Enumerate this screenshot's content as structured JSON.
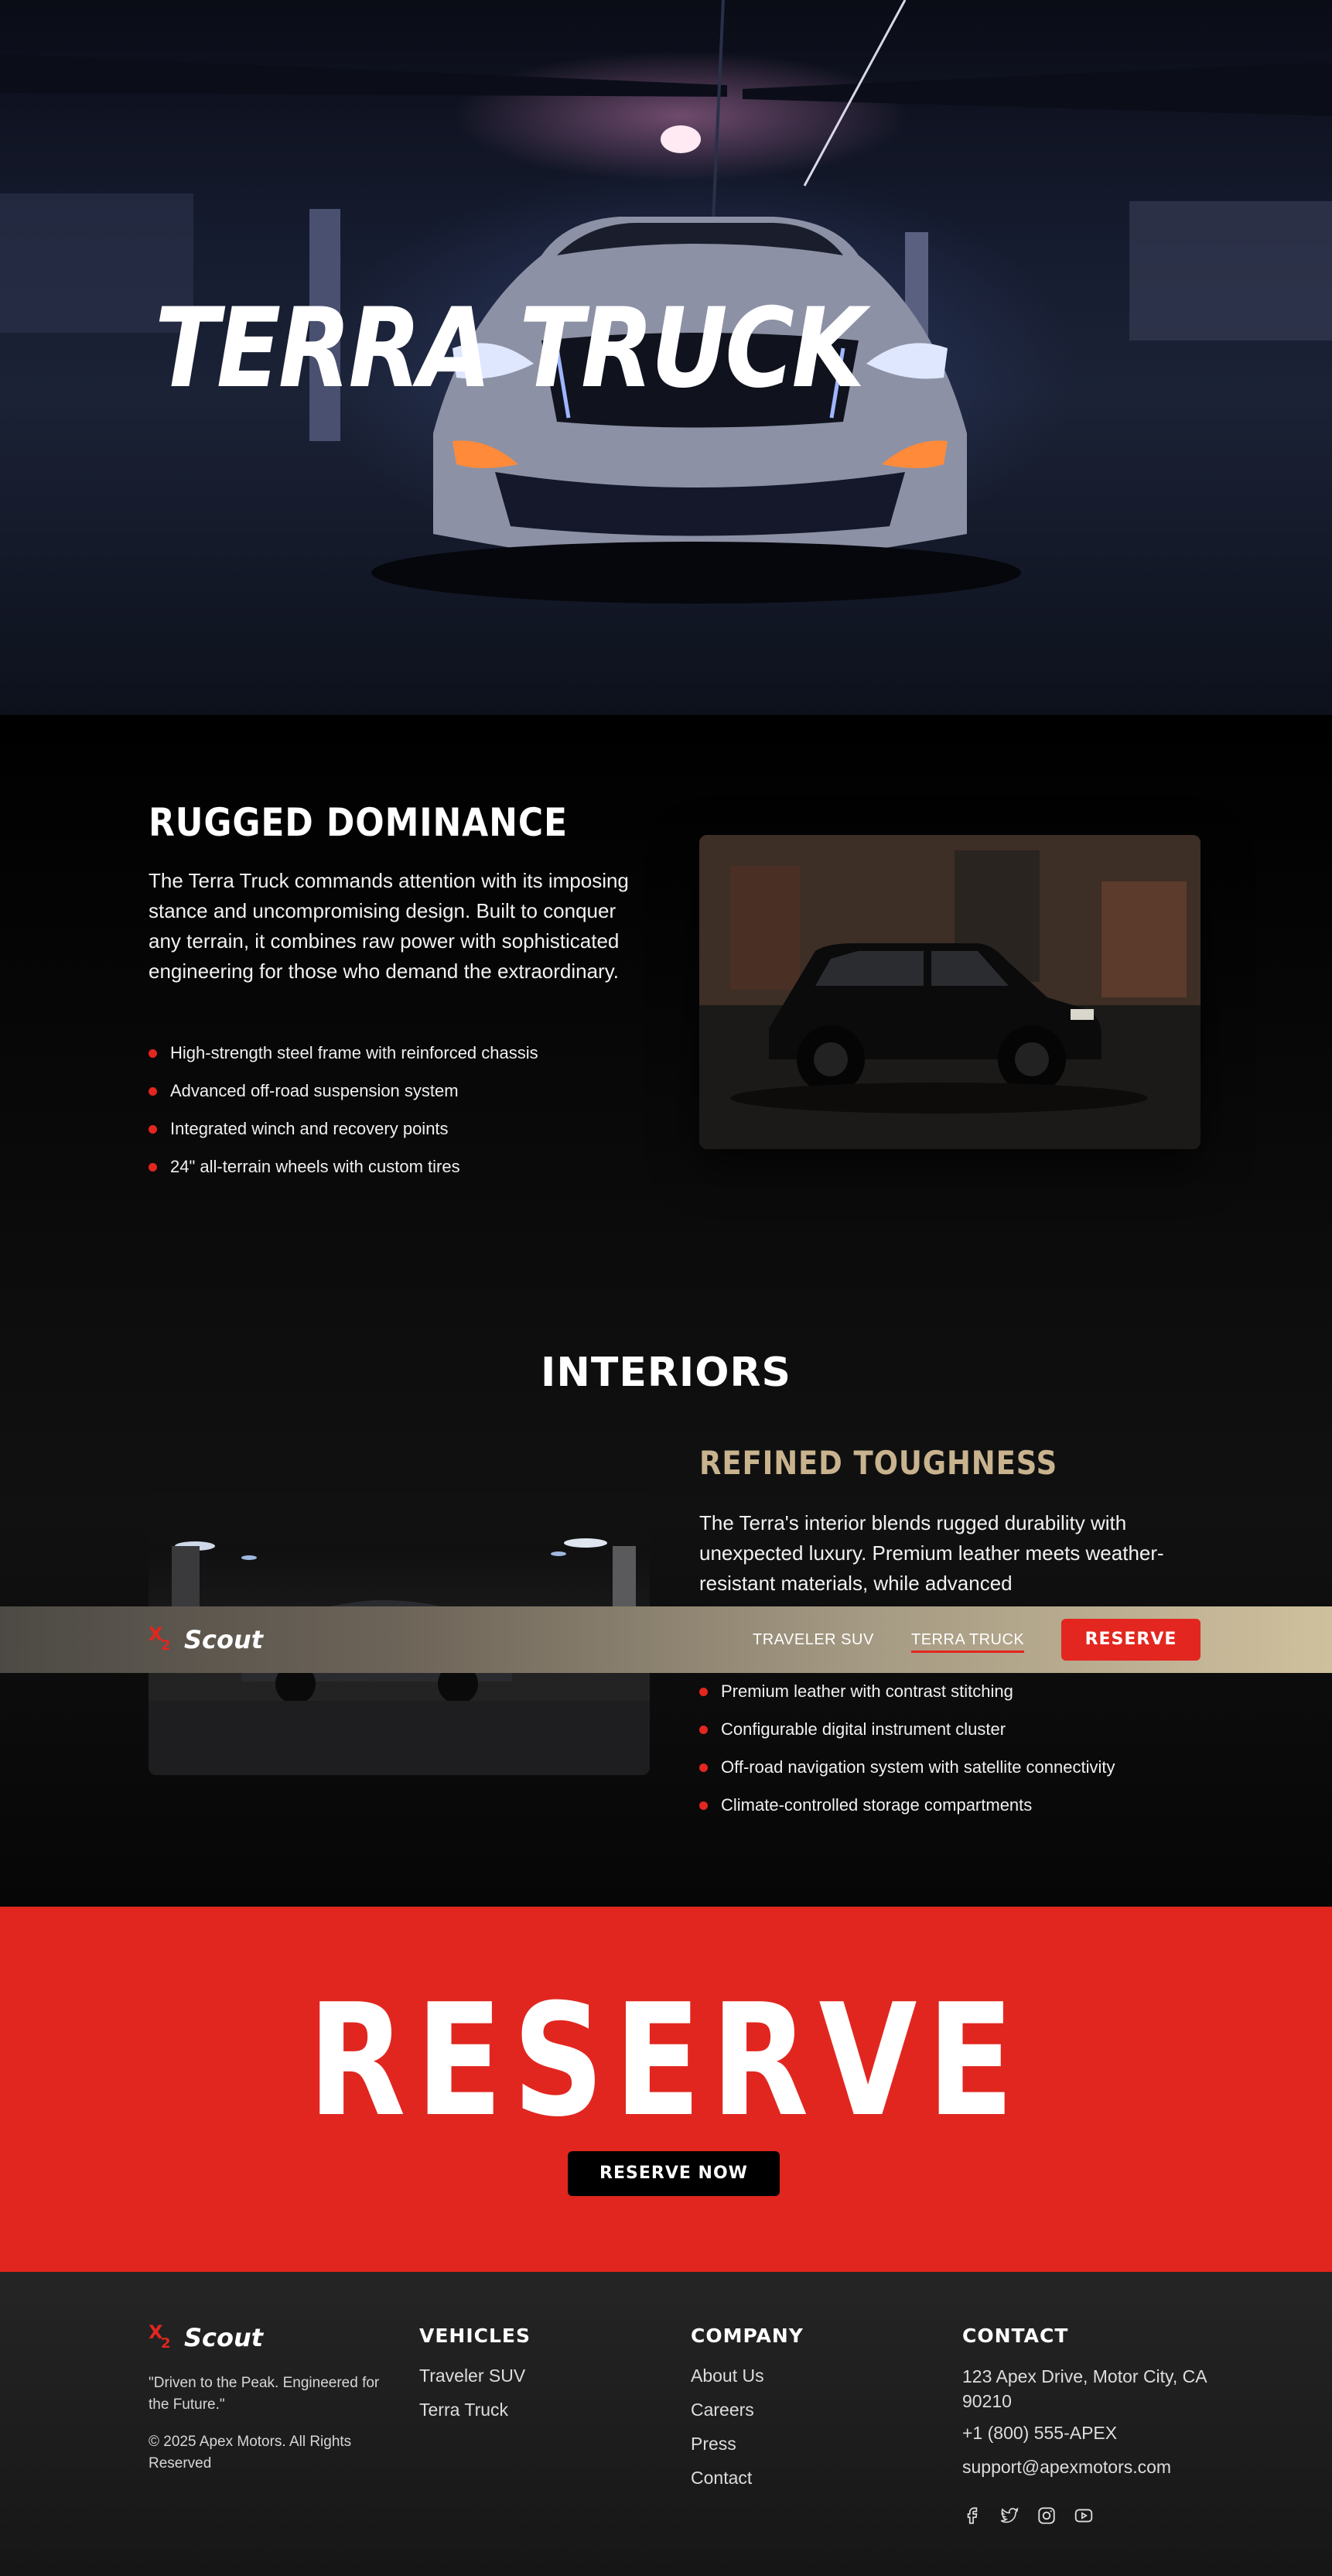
{
  "hero": {
    "title": "TERRA TRUCK"
  },
  "rugged": {
    "heading": "RUGGED DOMINANCE",
    "paragraph": "The Terra Truck commands attention with its imposing stance and uncompromising design. Built to conquer any terrain, it combines raw power with sophisticated engineering for those who demand the extraordinary.",
    "features": [
      "High-strength steel frame with reinforced chassis",
      "Advanced off-road suspension system",
      "Integrated winch and recovery points",
      "24\" all-terrain wheels with custom tires"
    ]
  },
  "interiors": {
    "heading": "INTERIORS",
    "subheading": "REFINED TOUGHNESS",
    "paragraph": "The Terra's interior blends rugged durability with unexpected luxury. Premium leather meets weather-resistant materials, while advanced",
    "features": [
      "Premium leather with contrast stitching",
      "Configurable digital instrument cluster",
      "Off-road navigation system with satellite connectivity",
      "Climate-controlled storage compartments"
    ]
  },
  "nav": {
    "logo_mark": "X",
    "logo_sub": "2",
    "logo_word": "Scout",
    "links": [
      "TRAVELER SUV",
      "TERRA TRUCK"
    ],
    "active_link": "TERRA TRUCK",
    "cta": "RESERVE"
  },
  "reserve": {
    "title": "RESERVE",
    "button": "RESERVE NOW"
  },
  "footer": {
    "logo_mark": "X",
    "logo_sub": "2",
    "logo_word": "Scout",
    "tagline": "\"Driven to the Peak. Engineered for the Future.\"",
    "copyright": "© 2025 Apex Motors. All Rights Reserved",
    "vehicles": {
      "heading": "VEHICLES",
      "links": [
        "Traveler SUV",
        "Terra Truck"
      ]
    },
    "company": {
      "heading": "COMPANY",
      "links": [
        "About Us",
        "Careers",
        "Press",
        "Contact"
      ]
    },
    "contact": {
      "heading": "CONTACT",
      "address": "123 Apex Drive, Motor City, CA 90210",
      "phone": "+1 (800) 555-APEX",
      "email": "support@apexmotors.com"
    },
    "socials": [
      "facebook-icon",
      "twitter-icon",
      "instagram-icon",
      "youtube-icon"
    ]
  },
  "colors": {
    "accent": "#e3261f",
    "gold": "#c9b38e",
    "background": "#000000",
    "footer": "#1e1e1e"
  }
}
